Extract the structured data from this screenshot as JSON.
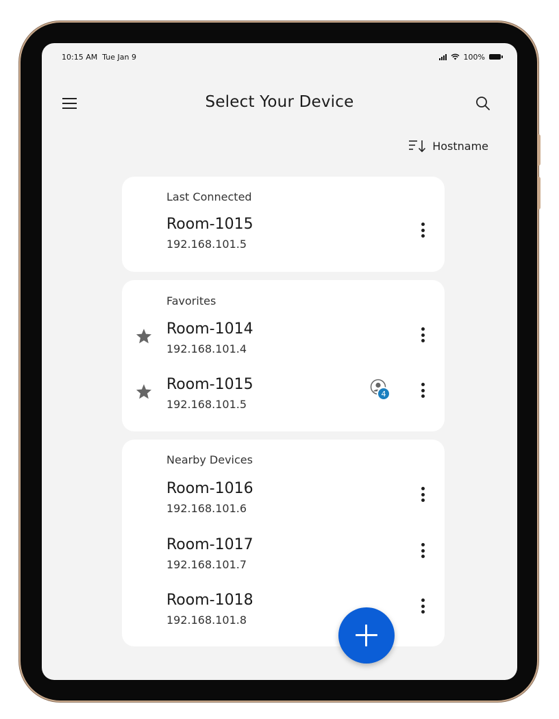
{
  "status_bar": {
    "time": "10:15 AM",
    "date": "Tue Jan 9",
    "battery": "100%"
  },
  "header": {
    "title": "Select Your Device",
    "menu_icon": "hamburger-menu-icon",
    "search_icon": "search-icon"
  },
  "sort": {
    "label": "Hostname",
    "icon": "sort-descending-icon"
  },
  "sections": [
    {
      "title": "Last Connected",
      "devices": [
        {
          "name": "Room-1015",
          "ip": "192.168.101.5",
          "favorite": false
        }
      ]
    },
    {
      "title": "Favorites",
      "devices": [
        {
          "name": "Room-1014",
          "ip": "192.168.101.4",
          "favorite": true
        },
        {
          "name": "Room-1015",
          "ip": "192.168.101.5",
          "favorite": true,
          "users_count": "4"
        }
      ]
    },
    {
      "title": "Nearby Devices",
      "devices": [
        {
          "name": "Room-1016",
          "ip": "192.168.101.6",
          "favorite": false
        },
        {
          "name": "Room-1017",
          "ip": "192.168.101.7",
          "favorite": false
        },
        {
          "name": "Room-1018",
          "ip": "192.168.101.8",
          "favorite": false
        }
      ]
    }
  ],
  "fab": {
    "icon": "plus-icon"
  },
  "colors": {
    "accent": "#0b5ed7",
    "badge": "#1a7fbf",
    "background": "#f3f3f3",
    "card": "#ffffff"
  }
}
